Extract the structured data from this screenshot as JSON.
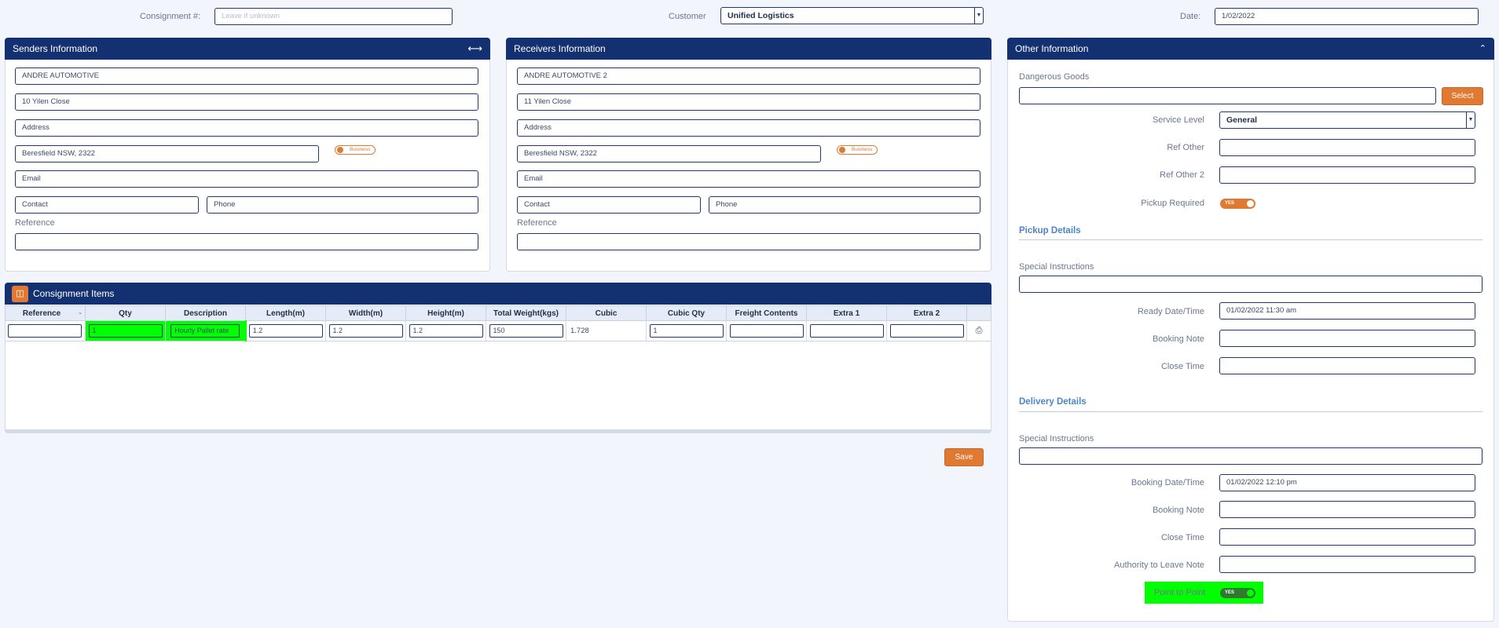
{
  "header": {
    "consignment_label": "Consignment #:",
    "consignment_placeholder": "Leave if unknown",
    "customer_label": "Customer",
    "customer_value": "Unified Logistics",
    "date_label": "Date:",
    "date_value": "1/02/2022"
  },
  "senders": {
    "title": "Senders Information",
    "name": "ANDRE AUTOMOTIVE",
    "street": "10 Yilen Close",
    "address": "Address",
    "suburb": "Beresfield NSW, 2322",
    "toggle": "Business",
    "email": "Email",
    "contact": "Contact",
    "phone": "Phone",
    "reference_label": "Reference",
    "reference_value": ""
  },
  "receivers": {
    "title": "Receivers Information",
    "name": "ANDRE AUTOMOTIVE 2",
    "street": "11 Yilen Close",
    "address": "Address",
    "suburb": "Beresfield NSW, 2322",
    "toggle": "Business",
    "email": "Email",
    "contact": "Contact",
    "phone": "Phone",
    "reference_label": "Reference",
    "reference_value": ""
  },
  "items": {
    "title": "Consignment Items",
    "columns": [
      "Reference",
      "Qty",
      "Description",
      "Length(m)",
      "Width(m)",
      "Height(m)",
      "Total Weight(kgs)",
      "Cubic",
      "Cubic Qty",
      "Freight Contents",
      "Extra 1",
      "Extra 2"
    ],
    "row": {
      "reference": "",
      "qty": "1",
      "description": "Hourly Pallet rate",
      "length": "1.2",
      "width": "1.2",
      "height": "1.2",
      "weight": "150",
      "cubic": "1.728",
      "cubic_qty": "1",
      "freight": "",
      "extra1": "",
      "extra2": ""
    },
    "save_label": "Save"
  },
  "other": {
    "title": "Other Information",
    "dangerous_goods_label": "Dangerous Goods",
    "select_label": "Select",
    "service_level_label": "Service Level",
    "service_level_value": "General",
    "ref_other_label": "Ref Other",
    "ref_other2_label": "Ref Other 2",
    "pickup_required_label": "Pickup Required",
    "pickup_required_value": "YES",
    "pickup": {
      "title": "Pickup Details",
      "special_label": "Special Instructions",
      "ready_label": "Ready Date/Time",
      "ready_value": "01/02/2022 11:30 am",
      "booking_note_label": "Booking Note",
      "close_time_label": "Close Time"
    },
    "delivery": {
      "title": "Delivery Details",
      "special_label": "Special Instructions",
      "booking_dt_label": "Booking Date/Time",
      "booking_dt_value": "01/02/2022 12:10 pm",
      "booking_note_label": "Booking Note",
      "close_time_label": "Close Time",
      "authority_label": "Authority to Leave Note",
      "p2p_label": "Point to Point",
      "p2p_value": "YES"
    }
  }
}
